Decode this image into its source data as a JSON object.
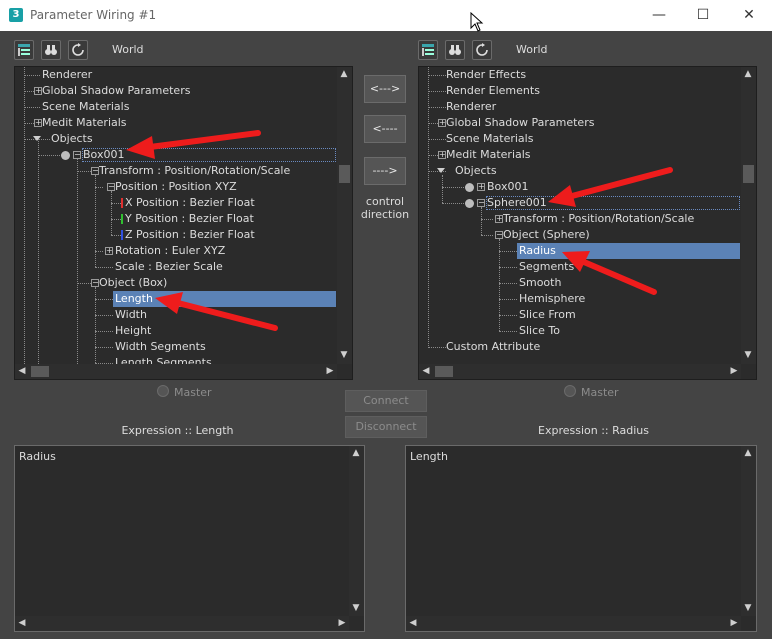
{
  "window": {
    "title": "Parameter Wiring #1",
    "app_icon_glyph": "3",
    "minimize_glyph": "—",
    "maximize_glyph": "☐",
    "close_glyph": "✕"
  },
  "left_panel": {
    "world_label": "World",
    "rows": [
      {
        "label": "Renderer",
        "expander": ""
      },
      {
        "label": "Global Shadow Parameters",
        "expander": "+"
      },
      {
        "label": "Scene Materials",
        "expander": ""
      },
      {
        "label": "Medit Materials",
        "expander": "+"
      },
      {
        "label": "Objects",
        "expander": ""
      },
      {
        "label": "Box001",
        "expander": "−"
      },
      {
        "label": "Transform : Position/Rotation/Scale",
        "expander": "−"
      },
      {
        "label": "Position : Position XYZ",
        "expander": "−"
      },
      {
        "label": "X Position : Bezier Float",
        "expander": ""
      },
      {
        "label": "Y Position : Bezier Float",
        "expander": ""
      },
      {
        "label": "Z Position : Bezier Float",
        "expander": ""
      },
      {
        "label": "Rotation : Euler XYZ",
        "expander": "+"
      },
      {
        "label": "Scale : Bezier Scale",
        "expander": ""
      },
      {
        "label": "Object (Box)",
        "expander": "−"
      },
      {
        "label": "Length",
        "expander": ""
      },
      {
        "label": "Width",
        "expander": ""
      },
      {
        "label": "Height",
        "expander": ""
      },
      {
        "label": "Width Segments",
        "expander": ""
      },
      {
        "label": "Length Segments",
        "expander": ""
      }
    ],
    "master_label": "Master",
    "expression_label": "Expression :: Length",
    "expression_text": "Radius"
  },
  "right_panel": {
    "world_label": "World",
    "rows": [
      {
        "label": "Render Effects",
        "expander": ""
      },
      {
        "label": "Render Elements",
        "expander": ""
      },
      {
        "label": "Renderer",
        "expander": ""
      },
      {
        "label": "Global Shadow Parameters",
        "expander": "+"
      },
      {
        "label": "Scene Materials",
        "expander": ""
      },
      {
        "label": "Medit Materials",
        "expander": "+"
      },
      {
        "label": "Objects",
        "expander": ""
      },
      {
        "label": "Box001",
        "expander": "+"
      },
      {
        "label": "Sphere001",
        "expander": "−"
      },
      {
        "label": "Transform : Position/Rotation/Scale",
        "expander": "+"
      },
      {
        "label": "Object (Sphere)",
        "expander": "−"
      },
      {
        "label": "Radius",
        "expander": ""
      },
      {
        "label": "Segments",
        "expander": ""
      },
      {
        "label": "Smooth",
        "expander": ""
      },
      {
        "label": "Hemisphere",
        "expander": ""
      },
      {
        "label": "Slice From",
        "expander": ""
      },
      {
        "label": "Slice To",
        "expander": ""
      },
      {
        "label": "Custom Attribute",
        "expander": ""
      }
    ],
    "master_label": "Master",
    "expression_label": "Expression :: Radius",
    "expression_text": "Length"
  },
  "middle": {
    "two_way_label": "<--->",
    "right_to_left_label": "<----",
    "left_to_right_label": "---->",
    "control_direction_line1": "control",
    "control_direction_line2": "direction",
    "connect_label": "Connect",
    "disconnect_label": "Disconnect"
  },
  "colors": {
    "selection": "#5b82b6",
    "annotation_arrow": "#ee1c1c",
    "x_axis": "#e03030",
    "y_axis": "#30c030",
    "z_axis": "#3050e0"
  }
}
